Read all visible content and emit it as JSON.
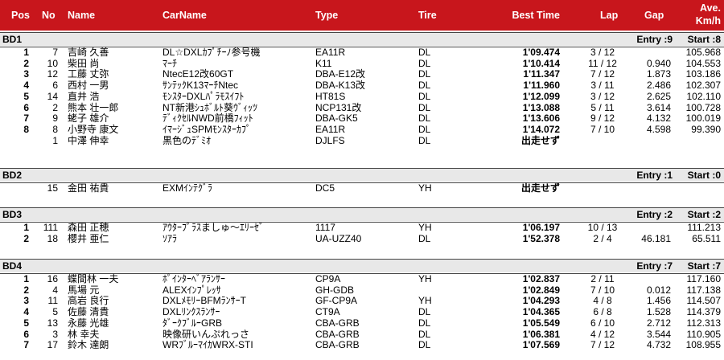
{
  "header": {
    "pos": "Pos",
    "no": "No",
    "name": "Name",
    "car": "CarName",
    "type": "Type",
    "tire": "Tire",
    "best": "Best Time",
    "lap": "Lap",
    "gap": "Gap",
    "ave1": "Ave.",
    "ave2": "Km/h"
  },
  "groups": [
    {
      "label": "BD1",
      "entry": "Entry :9",
      "start": "Start :8",
      "rows": [
        {
          "pos": "1",
          "no": "7",
          "name": "吉崎 久善",
          "car": "DL☆DXLｶﾌﾟﾁｰﾉ参号機",
          "type": "EA11R",
          "tire": "DL",
          "best": "1'09.474",
          "lap": "3 / 12",
          "gap": "",
          "ave": "105.968"
        },
        {
          "pos": "2",
          "no": "10",
          "name": "柴田 尚",
          "car": "ﾏｰﾁ",
          "type": "K11",
          "tire": "DL",
          "best": "1'10.414",
          "lap": "11 / 12",
          "gap": "0.940",
          "ave": "104.553"
        },
        {
          "pos": "3",
          "no": "12",
          "name": "工藤 丈弥",
          "car": "NtecE12改60GT",
          "type": "DBA-E12改",
          "tire": "DL",
          "best": "1'11.347",
          "lap": "7 / 12",
          "gap": "1.873",
          "ave": "103.186"
        },
        {
          "pos": "4",
          "no": "6",
          "name": "西村 一男",
          "car": "ｻﾝﾃｯｸK13ﾏｰﾁNtec",
          "type": "DBA-K13改",
          "tire": "DL",
          "best": "1'11.960",
          "lap": "3 / 11",
          "gap": "2.486",
          "ave": "102.307"
        },
        {
          "pos": "5",
          "no": "14",
          "name": "直井 浩",
          "car": "ﾓﾝｽﾀｰDXLﾊﾟﾗﾓｽｲﾌﾄ",
          "type": "HT81S",
          "tire": "DL",
          "best": "1'12.099",
          "lap": "3 / 12",
          "gap": "2.625",
          "ave": "102.110"
        },
        {
          "pos": "6",
          "no": "2",
          "name": "熊本 壮一郎",
          "car": "NT新港ｼｭﾎﾞﾙﾄ葵ｳﾞｨｯﾂ",
          "type": "NCP131改",
          "tire": "DL",
          "best": "1'13.088",
          "lap": "5 / 11",
          "gap": "3.614",
          "ave": "100.728"
        },
        {
          "pos": "7",
          "no": "9",
          "name": "蛯子 雄介",
          "car": "ﾃﾞｨｸｾﾙNWD前橋ﾌｨｯﾄ",
          "type": "DBA-GK5",
          "tire": "DL",
          "best": "1'13.606",
          "lap": "9 / 12",
          "gap": "4.132",
          "ave": "100.019"
        },
        {
          "pos": "8",
          "no": "8",
          "name": "小野寺 康文",
          "car": "ｲﾏｰｼﾞｭSPMﾓﾝｽﾀｰｶﾌﾟ",
          "type": "EA11R",
          "tire": "DL",
          "best": "1'14.072",
          "lap": "7 / 10",
          "gap": "4.598",
          "ave": "99.390"
        },
        {
          "pos": "",
          "no": "1",
          "name": "中澤 伸幸",
          "car": "黒色のﾃﾞﾐｵ",
          "type": "DJLFS",
          "tire": "DL",
          "best": "出走せず",
          "lap": "",
          "gap": "",
          "ave": ""
        }
      ]
    },
    {
      "label": "BD2",
      "entry": "Entry :1",
      "start": "Start :0",
      "rows": [
        {
          "pos": "",
          "no": "15",
          "name": "金田 祐貴",
          "car": "EXMｲﾝﾃｸﾞﾗ",
          "type": "DC5",
          "tire": "YH",
          "best": "出走せず",
          "lap": "",
          "gap": "",
          "ave": ""
        }
      ]
    },
    {
      "label": "BD3",
      "entry": "Entry :2",
      "start": "Start :2",
      "rows": [
        {
          "pos": "1",
          "no": "111",
          "name": "森田 正穂",
          "car": "ｱｳﾀｰﾌﾟﾗｽましゅ～ｴﾘｰｾﾞ",
          "type": "1117",
          "tire": "YH",
          "best": "1'06.197",
          "lap": "10 / 13",
          "gap": "",
          "ave": "111.213"
        },
        {
          "pos": "2",
          "no": "18",
          "name": "櫻井 亜仁",
          "car": "ｿｱﾗ",
          "type": "UA-UZZ40",
          "tire": "DL",
          "best": "1'52.378",
          "lap": "2 / 4",
          "gap": "46.181",
          "ave": "65.511"
        }
      ]
    },
    {
      "label": "BD4",
      "entry": "Entry :7",
      "start": "Start :7",
      "rows": [
        {
          "pos": "1",
          "no": "16",
          "name": "蝶間林 一夫",
          "car": "ﾎﾟｲﾝﾀｰﾍﾞｱﾗﾝｻｰ",
          "type": "CP9A",
          "tire": "YH",
          "best": "1'02.837",
          "lap": "2 / 11",
          "gap": "",
          "ave": "117.160"
        },
        {
          "pos": "2",
          "no": "4",
          "name": "馬場 元",
          "car": "ALEXｲﾝﾌﾟﾚｯｻ",
          "type": "GH-GDB",
          "tire": "",
          "best": "1'02.849",
          "lap": "7 / 10",
          "gap": "0.012",
          "ave": "117.138"
        },
        {
          "pos": "3",
          "no": "11",
          "name": "高岩 良行",
          "car": "DXLﾒﾓﾘｰBFMﾗﾝｻｰT",
          "type": "GF-CP9A",
          "tire": "YH",
          "best": "1'04.293",
          "lap": "4 / 8",
          "gap": "1.456",
          "ave": "114.507"
        },
        {
          "pos": "4",
          "no": "5",
          "name": "佐藤 清貴",
          "car": "DXLﾘﾝｸｽﾗﾝｻｰ",
          "type": "CT9A",
          "tire": "DL",
          "best": "1'04.365",
          "lap": "6 / 8",
          "gap": "1.528",
          "ave": "114.379"
        },
        {
          "pos": "5",
          "no": "13",
          "name": "永藤 光雄",
          "car": "ﾀﾞｰｸﾌﾞﾙｰGRB",
          "type": "CBA-GRB",
          "tire": "DL",
          "best": "1'05.549",
          "lap": "6 / 10",
          "gap": "2.712",
          "ave": "112.313"
        },
        {
          "pos": "6",
          "no": "3",
          "name": "林 幸夫",
          "car": "映像研いんぷれっさ",
          "type": "CBA-GRB",
          "tire": "DL",
          "best": "1'06.381",
          "lap": "4 / 12",
          "gap": "3.544",
          "ave": "110.905"
        },
        {
          "pos": "7",
          "no": "17",
          "name": "鈴木 達朗",
          "car": "WRﾌﾞﾙｰﾏｲｶWRX-STI",
          "type": "CBA-GRB",
          "tire": "DL",
          "best": "1'07.569",
          "lap": "7 / 12",
          "gap": "4.732",
          "ave": "108.955"
        }
      ]
    }
  ]
}
